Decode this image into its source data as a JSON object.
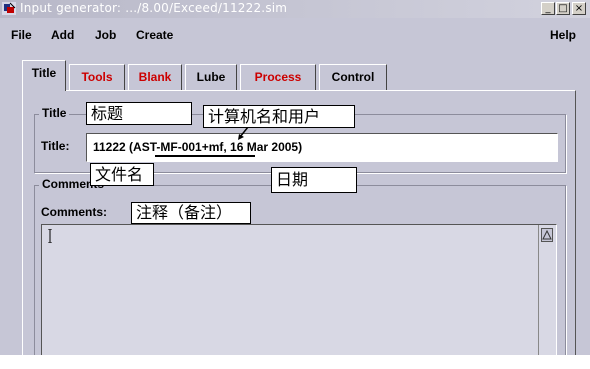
{
  "window": {
    "title": "Input generator: .../8.00/Exceed/11222.sim",
    "controls": [
      "_",
      "□",
      "×"
    ]
  },
  "menu": {
    "items": [
      "File",
      "Add",
      "Job",
      "Create"
    ],
    "help": "Help"
  },
  "tabs": [
    {
      "label": "Title",
      "color": "#000000",
      "active": true
    },
    {
      "label": "Tools",
      "color": "#cc0000"
    },
    {
      "label": "Blank",
      "color": "#cc0000"
    },
    {
      "label": "Lube",
      "color": "#000000"
    },
    {
      "label": "Process",
      "color": "#cc0000"
    },
    {
      "label": "Control",
      "color": "#000000"
    }
  ],
  "title_group": {
    "legend": "Title",
    "field_label": "Title:",
    "value": "11222 (AST-MF-001+mf, 16 Mar 2005)"
  },
  "comments_group": {
    "legend": "Comments",
    "field_label": "Comments:",
    "value": ""
  },
  "annotations": {
    "title_cn": "标题",
    "computer_user": "计算机名和用户",
    "filename": "文件名",
    "date": "日期",
    "comments_cn": "注释（备注）"
  }
}
